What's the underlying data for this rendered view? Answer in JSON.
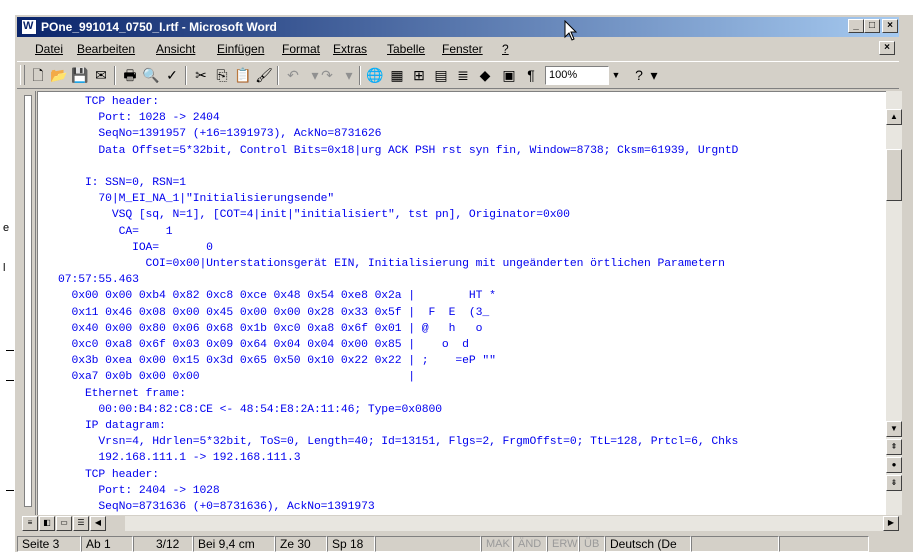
{
  "window": {
    "title": "POne_991014_0750_I.rtf - Microsoft Word"
  },
  "menu": [
    "Datei",
    "Bearbeiten",
    "Ansicht",
    "Einfügen",
    "Format",
    "Extras",
    "Tabelle",
    "Fenster",
    "?"
  ],
  "toolbar": {
    "zoom_value": "100%"
  },
  "document": {
    "lines": [
      "    TCP header:",
      "      Port: 1028 -> 2404",
      "      SeqNo=1391957 (+16=1391973), AckNo=8731626",
      "      Data Offset=5*32bit, Control Bits=0x18|urg ACK PSH rst syn fin, Window=8738; Cksm=61939, UrgntD",
      "",
      "    I: SSN=0, RSN=1",
      "      70|M_EI_NA_1|\"Initialisierungsende\"",
      "        VSQ [sq, N=1], [COT=4|init|\"initialisiert\", tst pn], Originator=0x00",
      "         CA=    1",
      "           IOA=       0",
      "             COI=0x00|Unterstationsgerät EIN, Initialisierung mit ungeänderten örtlichen Parametern",
      "07:57:55.463",
      "  0x00 0x00 0xb4 0x82 0xc8 0xce 0x48 0x54 0xe8 0x2a |        HT *",
      "  0x11 0x46 0x08 0x00 0x45 0x00 0x00 0x28 0x33 0x5f |  F  E  (3_",
      "  0x40 0x00 0x80 0x06 0x68 0x1b 0xc0 0xa8 0x6f 0x01 | @   h   o",
      "  0xc0 0xa8 0x6f 0x03 0x09 0x64 0x04 0x04 0x00 0x85 |    o  d",
      "  0x3b 0xea 0x00 0x15 0x3d 0x65 0x50 0x10 0x22 0x22 | ;    =eP \"\"",
      "  0xa7 0x0b 0x00 0x00                               |",
      "    Ethernet frame:",
      "      00:00:B4:82:C8:CE <- 48:54:E8:2A:11:46; Type=0x0800",
      "    IP datagram:",
      "      Vrsn=4, Hdrlen=5*32bit, ToS=0, Length=40; Id=13151, Flgs=2, FrgmOffst=0; TtL=128, Prtcl=6, Chks",
      "      192.168.111.1 -> 192.168.111.3",
      "    TCP header:",
      "      Port: 2404 -> 1028",
      "      SeqNo=8731636 (+0=8731636), AckNo=1391973"
    ]
  },
  "status": {
    "page": "Seite 3",
    "section": "Ab 1",
    "pages": "3/12",
    "position": "Bei 9,4 cm",
    "line": "Ze 30",
    "column": "Sp 18",
    "mak": "MAK",
    "aend": "ÄND",
    "erw": "ERW",
    "ueb": "ÜB",
    "language": "Deutsch (De"
  },
  "left_strip": {
    "glyph_1": "e",
    "glyph_2": "l"
  },
  "colors": {
    "title_start": "#0a246a",
    "title_end": "#a6caf0",
    "document_text": "#0000ee",
    "chrome": "#d4d0c8"
  }
}
